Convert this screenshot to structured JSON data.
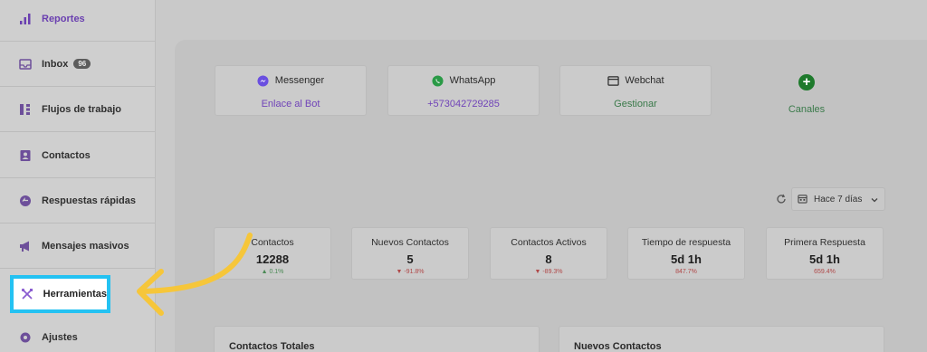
{
  "sidebar": {
    "items": [
      {
        "label": "Reportes",
        "icon": "bar-chart-icon",
        "active": true
      },
      {
        "label": "Inbox",
        "icon": "inbox-icon",
        "badge": "96"
      },
      {
        "label": "Flujos de trabajo",
        "icon": "workflow-icon"
      },
      {
        "label": "Contactos",
        "icon": "contacts-icon"
      },
      {
        "label": "Respuestas rápidas",
        "icon": "quick-reply-icon"
      },
      {
        "label": "Mensajes masivos",
        "icon": "megaphone-icon"
      },
      {
        "label": "Herramientas",
        "icon": "tools-icon",
        "highlighted": true
      },
      {
        "label": "Ajustes",
        "icon": "settings-icon"
      }
    ]
  },
  "channels": [
    {
      "name": "Messenger",
      "link": "Enlace al Bot",
      "icon": "messenger-icon"
    },
    {
      "name": "WhatsApp",
      "link": "+573042729285",
      "icon": "whatsapp-icon"
    },
    {
      "name": "Webchat",
      "link": "Gestionar",
      "icon": "webchat-icon"
    }
  ],
  "add_channel": {
    "label": "Canales",
    "icon": "plus-icon"
  },
  "filters": {
    "range": "Hace 7 días"
  },
  "stats": [
    {
      "title": "Contactos",
      "value": "12288",
      "delta": "0.1%",
      "trend": "up"
    },
    {
      "title": "Nuevos Contactos",
      "value": "5",
      "delta": "-91.8%",
      "trend": "down"
    },
    {
      "title": "Contactos Activos",
      "value": "8",
      "delta": "-89.3%",
      "trend": "down"
    },
    {
      "title": "Tiempo de respuesta",
      "value": "5d 1h",
      "delta": "847.7%",
      "trend": "down"
    },
    {
      "title": "Primera Respuesta",
      "value": "5d 1h",
      "delta": "659.4%",
      "trend": "down"
    }
  ],
  "panels": {
    "left_title": "Contactos Totales",
    "right_title": "Nuevos Contactos"
  },
  "colors": {
    "highlight_border": "#24c2f2",
    "arrow": "#f6c63a",
    "accent_purple": "#6a3fb0",
    "accent_green": "#1e7a2c"
  }
}
